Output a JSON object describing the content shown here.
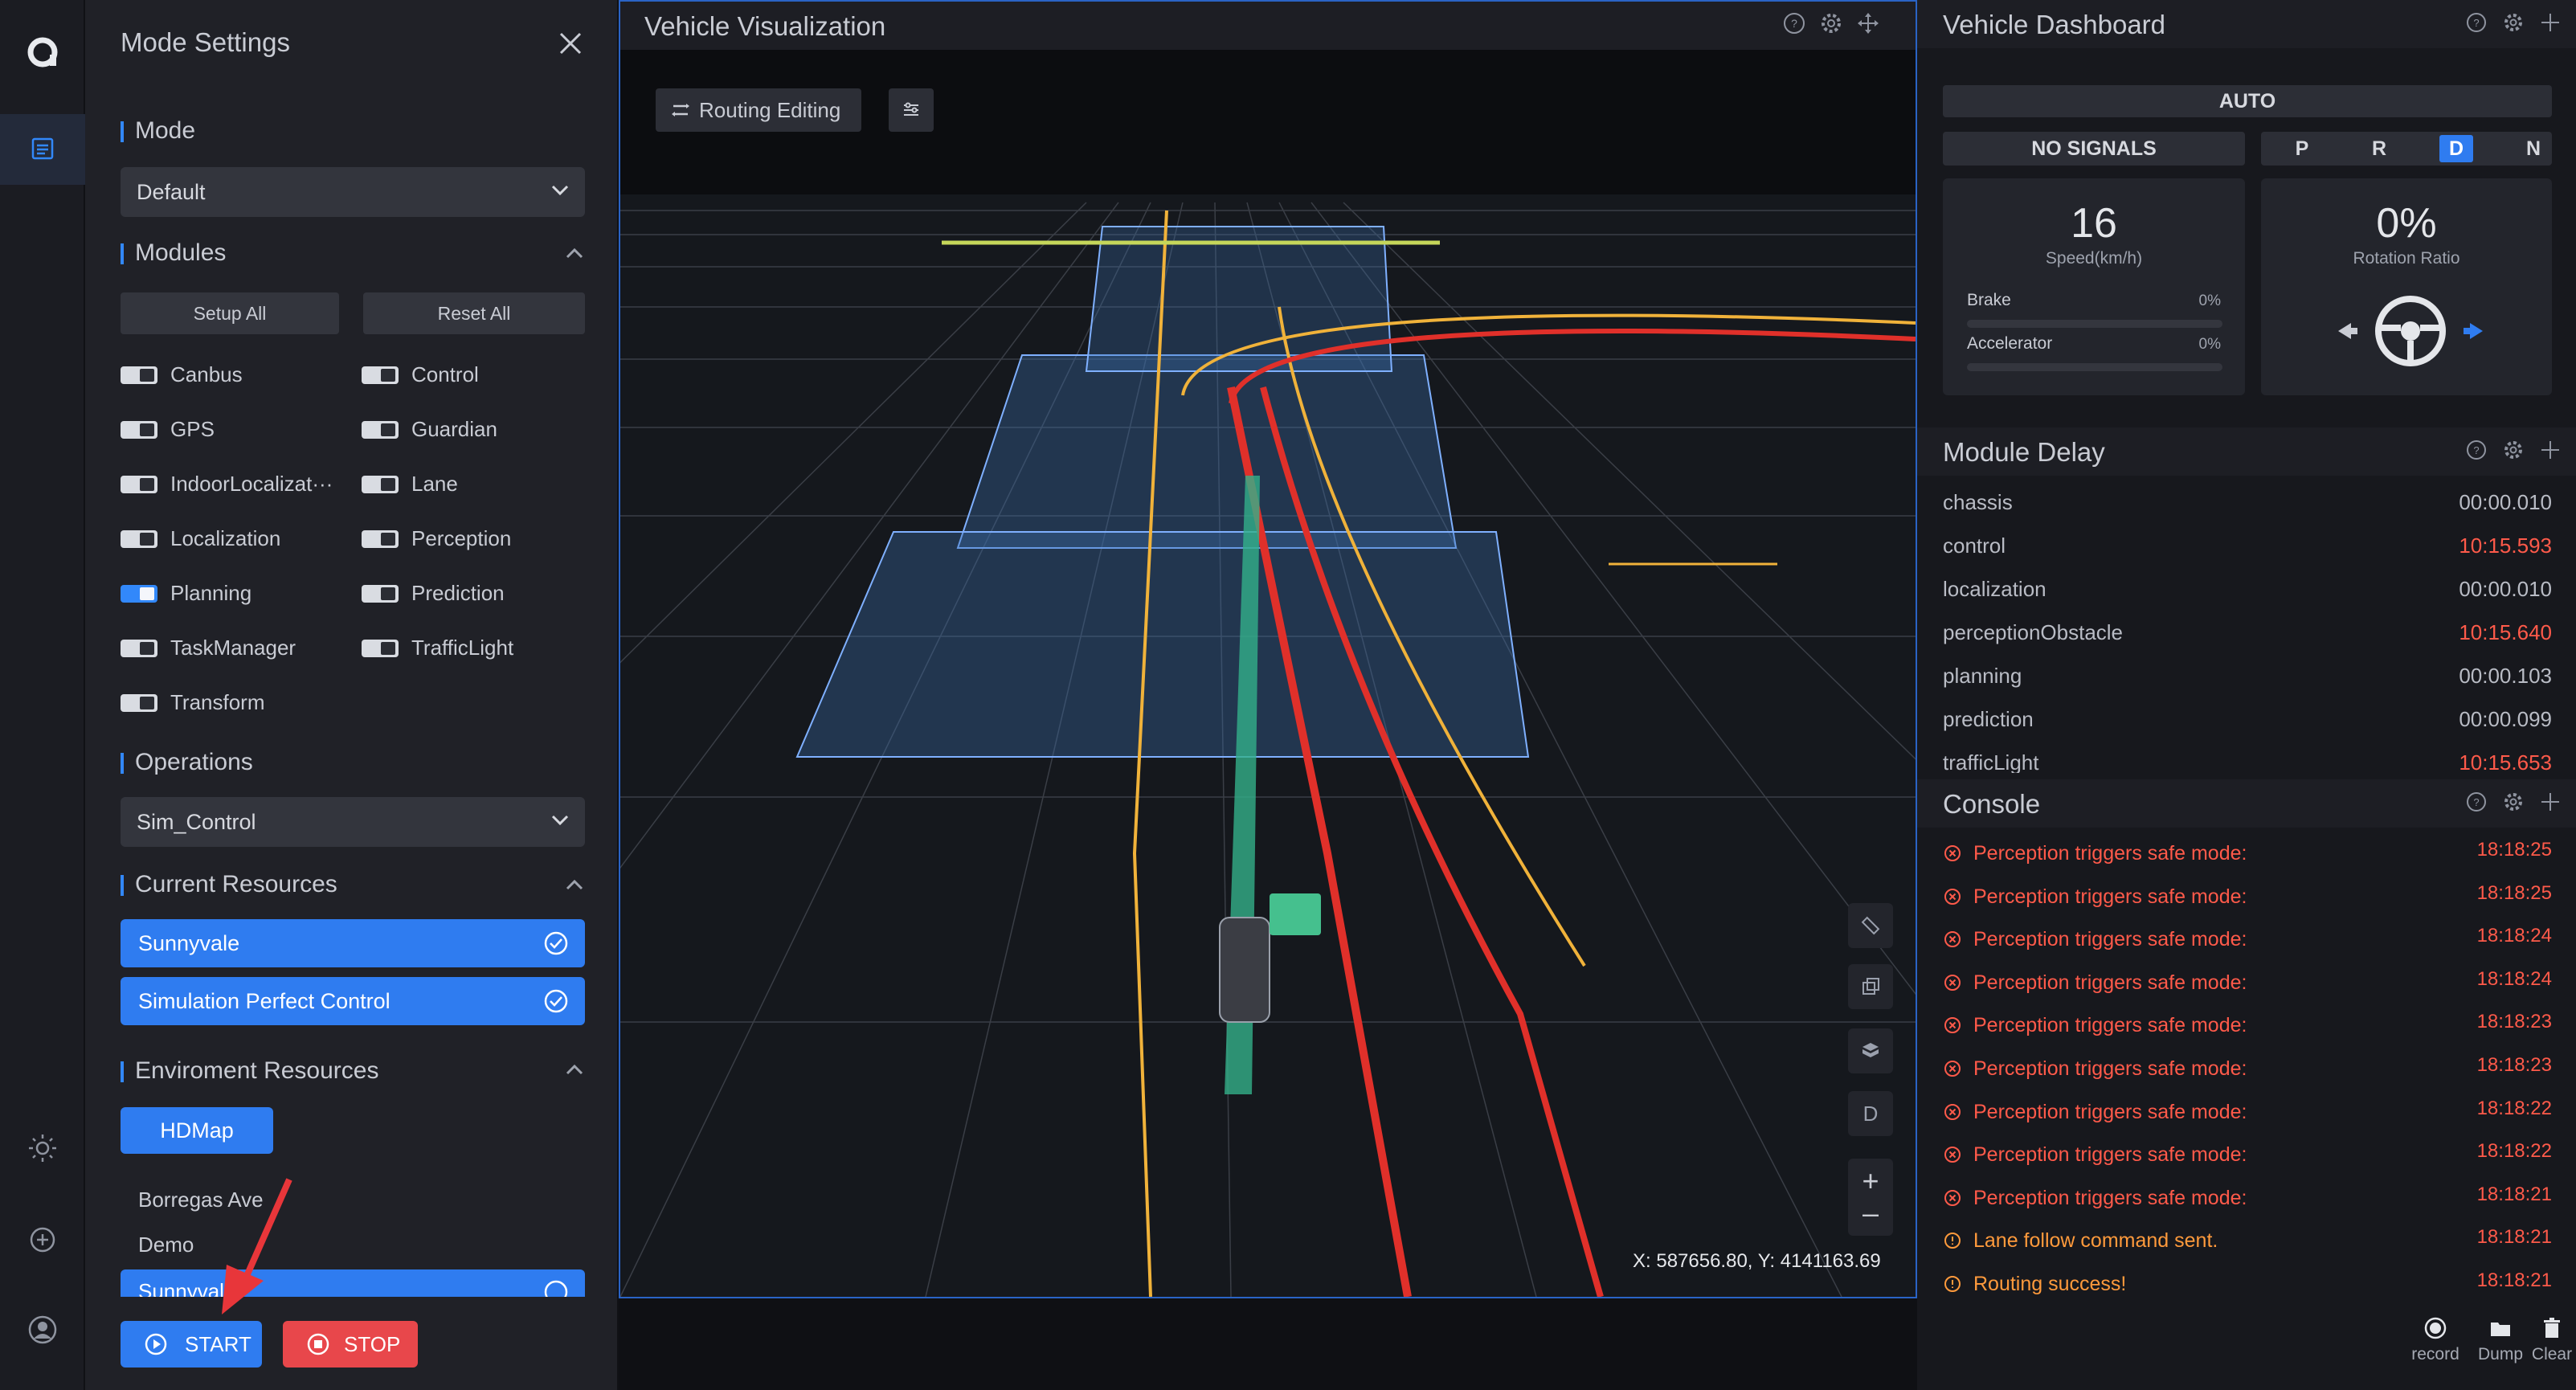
{
  "rail": {
    "icons": [
      "logo-icon",
      "list-icon",
      "sun-icon",
      "plus-circle-icon",
      "user-icon"
    ]
  },
  "settings": {
    "title": "Mode Settings",
    "mode": {
      "label": "Mode",
      "value": "Default"
    },
    "modules": {
      "label": "Modules",
      "setup_all": "Setup All",
      "reset_all": "Reset All",
      "items": [
        {
          "name": "Canbus",
          "on": false
        },
        {
          "name": "Control",
          "on": false
        },
        {
          "name": "GPS",
          "on": false
        },
        {
          "name": "Guardian",
          "on": false
        },
        {
          "name": "IndoorLocalizat···",
          "on": false
        },
        {
          "name": "Lane",
          "on": false
        },
        {
          "name": "Localization",
          "on": false
        },
        {
          "name": "Perception",
          "on": false
        },
        {
          "name": "Planning",
          "on": true
        },
        {
          "name": "Prediction",
          "on": false
        },
        {
          "name": "TaskManager",
          "on": false
        },
        {
          "name": "TrafficLight",
          "on": false
        },
        {
          "name": "Transform",
          "on": false
        }
      ]
    },
    "operations": {
      "label": "Operations",
      "value": "Sim_Control"
    },
    "current_resources": {
      "label": "Current Resources",
      "items": [
        "Sunnyvale",
        "Simulation Perfect Control"
      ]
    },
    "environment_resources": {
      "label": "Enviroment Resources",
      "tab": "HDMap",
      "maps": [
        "Borregas Ave",
        "Demo",
        "Sunnyvale"
      ]
    },
    "start_label": "START",
    "stop_label": "STOP"
  },
  "viz": {
    "title": "Vehicle Visualization",
    "routing_label": "Routing Editing",
    "tool_d": "D",
    "coords": "X: 587656.80, Y: 4141163.69"
  },
  "dashboard": {
    "title": "Vehicle Dashboard",
    "driving_mode": "AUTO",
    "signals": "NO SIGNALS",
    "gears": [
      "P",
      "R",
      "D",
      "N"
    ],
    "active_gear": "D",
    "speed": "16",
    "speed_caption": "Speed(km/h)",
    "brake_label": "Brake",
    "brake_value": "0%",
    "brake_fraction": 0,
    "accel_label": "Accelerator",
    "accel_value": "0%",
    "accel_fraction": 0,
    "rotation": "0%",
    "rotation_caption": "Rotation Ratio"
  },
  "module_delay": {
    "title": "Module Delay",
    "rows": [
      {
        "name": "chassis",
        "value": "00:00.010",
        "alert": false
      },
      {
        "name": "control",
        "value": "10:15.593",
        "alert": true
      },
      {
        "name": "localization",
        "value": "00:00.010",
        "alert": false
      },
      {
        "name": "perceptionObstacle",
        "value": "10:15.640",
        "alert": true
      },
      {
        "name": "planning",
        "value": "00:00.103",
        "alert": false
      },
      {
        "name": "prediction",
        "value": "00:00.099",
        "alert": false
      },
      {
        "name": "trafficLight",
        "value": "10:15.653",
        "alert": true
      }
    ]
  },
  "console": {
    "title": "Console",
    "rows": [
      {
        "level": "error",
        "msg": "Perception triggers safe mode:",
        "time": "18:18:25"
      },
      {
        "level": "error",
        "msg": "Perception triggers safe mode:",
        "time": "18:18:25"
      },
      {
        "level": "error",
        "msg": "Perception triggers safe mode:",
        "time": "18:18:24"
      },
      {
        "level": "error",
        "msg": "Perception triggers safe mode:",
        "time": "18:18:24"
      },
      {
        "level": "error",
        "msg": "Perception triggers safe mode:",
        "time": "18:18:23"
      },
      {
        "level": "error",
        "msg": "Perception triggers safe mode:",
        "time": "18:18:23"
      },
      {
        "level": "error",
        "msg": "Perception triggers safe mode:",
        "time": "18:18:22"
      },
      {
        "level": "error",
        "msg": "Perception triggers safe mode:",
        "time": "18:18:22"
      },
      {
        "level": "error",
        "msg": "Perception triggers safe mode:",
        "time": "18:18:21"
      },
      {
        "level": "warn",
        "msg": "Lane follow command sent.",
        "time": "18:18:21"
      },
      {
        "level": "warn",
        "msg": "Routing success!",
        "time": "18:18:21"
      }
    ]
  },
  "bottom": {
    "record": "record",
    "dump": "Dump",
    "clear": "Clear"
  },
  "colors": {
    "accent": "#2f7cf0",
    "stop": "#e8474b",
    "alert": "#ff5a4a",
    "warn": "#ff9a3c"
  }
}
